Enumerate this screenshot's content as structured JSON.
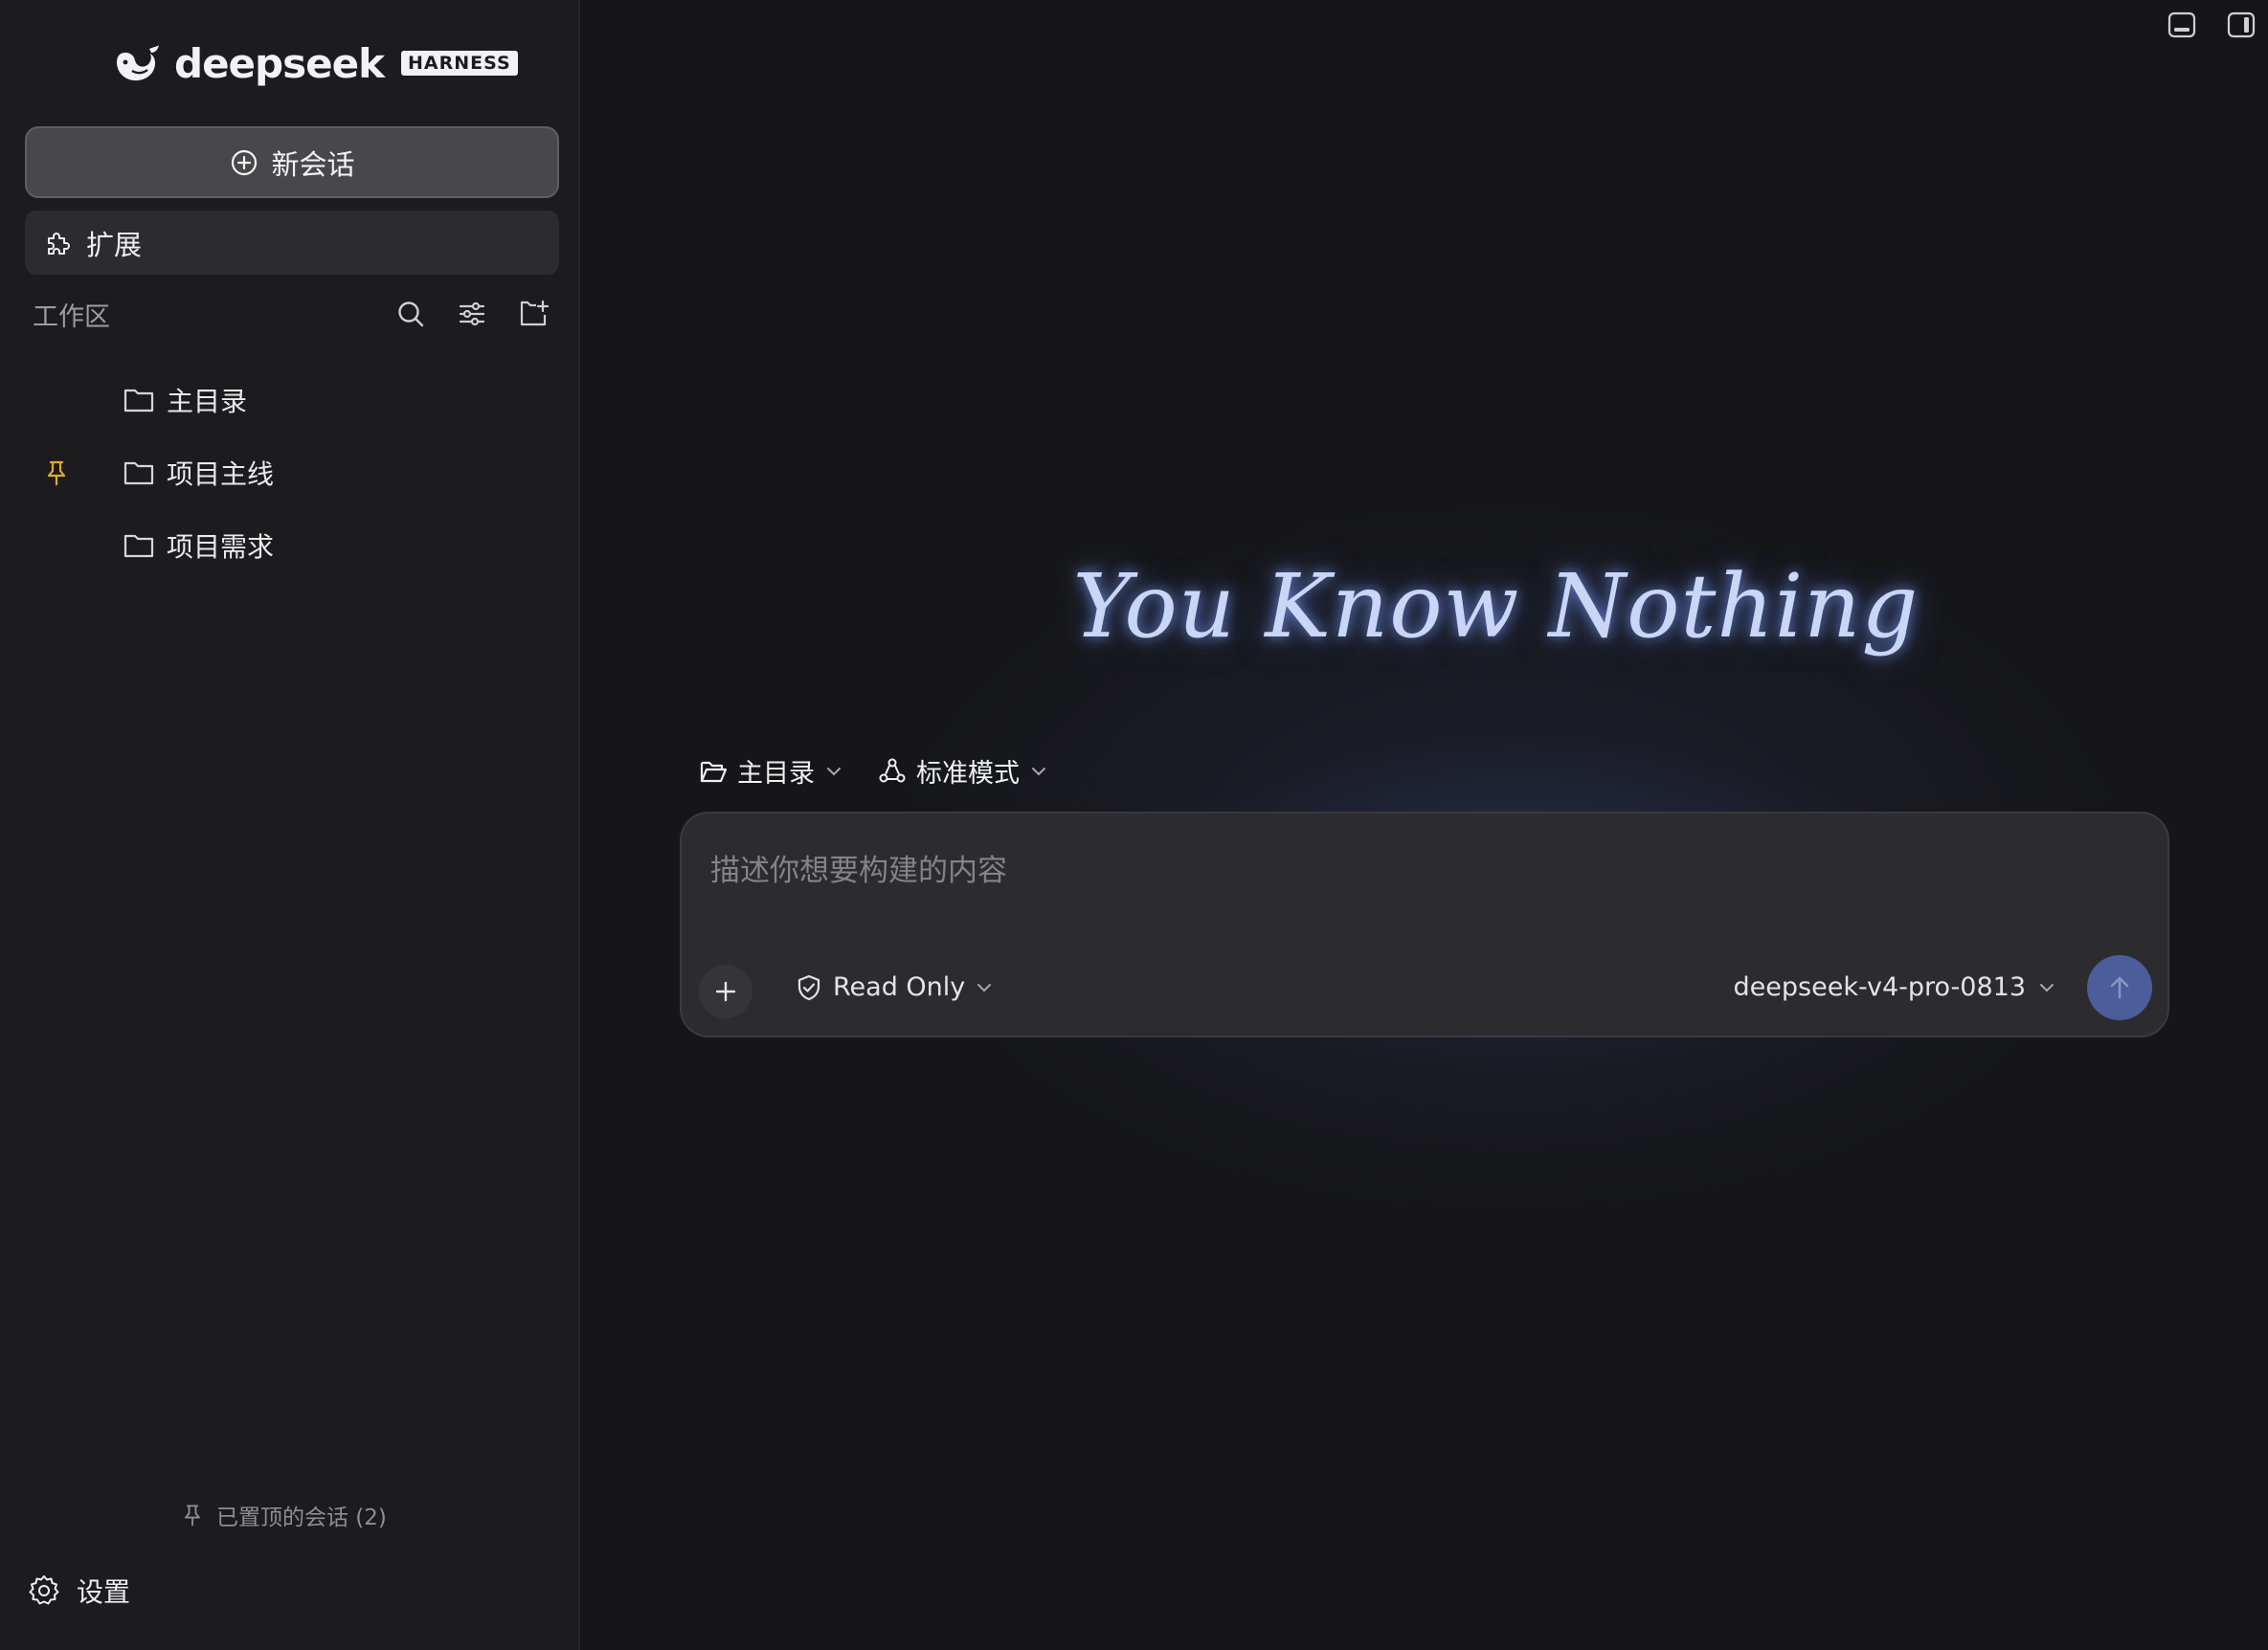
{
  "sidebar": {
    "brand": {
      "name": "deepseek",
      "badge": "HARNESS"
    },
    "new_chat_label": "新会话",
    "extensions_label": "扩展",
    "workspace": {
      "title": "工作区",
      "items": [
        {
          "label": "主目录",
          "pinned": false
        },
        {
          "label": "项目主线",
          "pinned": true
        },
        {
          "label": "项目需求",
          "pinned": false
        }
      ]
    },
    "pinned_chats_label": "已置顶的会话 (2)",
    "settings_label": "设置"
  },
  "main": {
    "hero_text": "You Know Nothing",
    "directory_selector": "主目录",
    "mode_selector": "标准模式",
    "composer": {
      "placeholder": "描述你想要构建的内容",
      "value": "",
      "permission_label": "Read Only",
      "model_label": "deepseek-v4-pro-0813"
    }
  },
  "colors": {
    "sidebar_bg": "#1c1c1e",
    "main_bg": "#161618",
    "pin_accent": "#e0a93a",
    "send_button": "#4b5d9a",
    "hero_glow": "#c9d6f6"
  }
}
